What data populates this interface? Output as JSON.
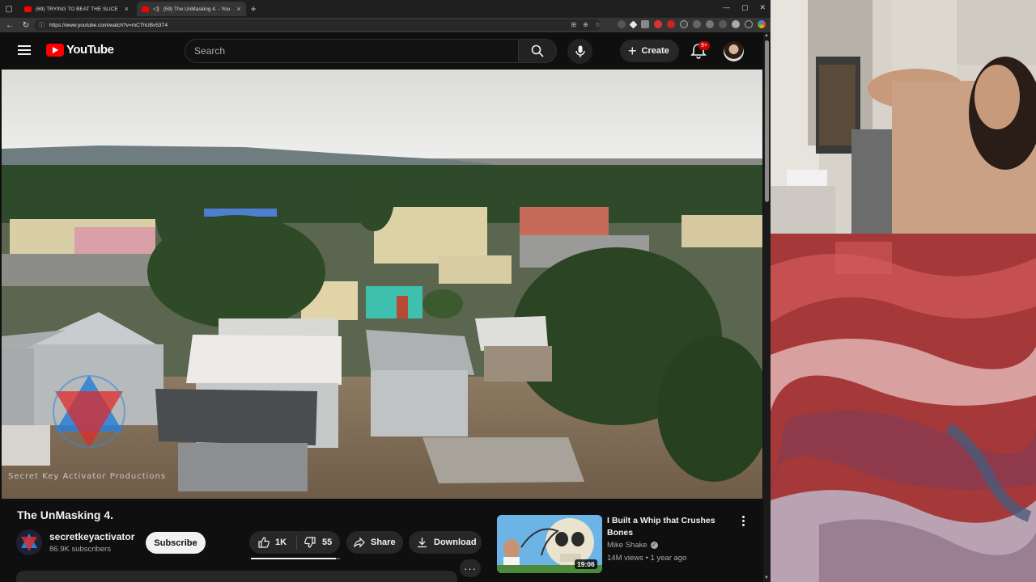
{
  "browser": {
    "tabs": [
      {
        "title": "(69) TRYING TO BEAT THE SLICE",
        "active": false
      },
      {
        "title": "(59) The UnMasking 4. - You",
        "active": true
      }
    ],
    "url": "https://www.youtube.com/watch?v=mC7hUBv53T4"
  },
  "masthead": {
    "logo_text": "YouTube",
    "search_placeholder": "Search",
    "create_label": "Create",
    "notification_count": "9+"
  },
  "video": {
    "watermark": "Secret Key Activator Productions",
    "title": "The UnMasking 4.",
    "channel_name": "secretkeyactivator",
    "subscribers": "86.9K subscribers",
    "subscribe_label": "Subscribe",
    "likes": "1K",
    "dislikes": "55",
    "share_label": "Share",
    "download_label": "Download",
    "more_label": "···"
  },
  "recommendation": {
    "title": "I Built a Whip that Crushes Bones",
    "channel": "Mike Shake",
    "verified_mark": "✓",
    "meta": "14M views • 1 year ago",
    "duration": "19:06"
  },
  "colors": {
    "youtube_red": "#ff0000",
    "background": "#0f0f0f",
    "chip": "#272727"
  }
}
